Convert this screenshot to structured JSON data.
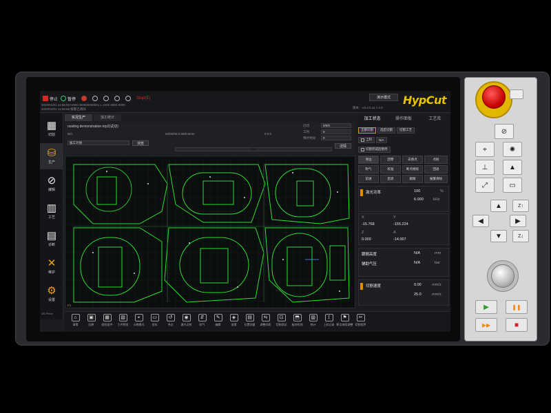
{
  "topbar": {
    "items": [
      {
        "label": "停止"
      },
      {
        "label": "暂停"
      },
      {
        "label": ""
      },
      {
        "label": ""
      },
      {
        "label": ""
      },
      {
        "label": ""
      },
      {
        "label": "Stop(E)"
      }
    ],
    "status_line_1": "2020/01/01 11:58:58  H000 000000000001  L 1000  0000 0000",
    "status_line_2": "2020/01/01 11:58:58  报警已清除",
    "mode_button": "演示模式",
    "version": "版本：V3.4.0.11.7.2.0",
    "brand": "HypCut"
  },
  "sidebar": {
    "items": [
      {
        "label": "切割",
        "glyph": "▦"
      },
      {
        "label": "生产",
        "glyph": "⛁"
      },
      {
        "label": "编辑",
        "glyph": "⊘"
      },
      {
        "label": "工艺",
        "glyph": "▥"
      },
      {
        "label": "诊断",
        "glyph": "▤"
      },
      {
        "label": "维护",
        "glyph": "✕"
      },
      {
        "label": "设置",
        "glyph": "⚙"
      }
    ]
  },
  "main": {
    "tabs": [
      {
        "label": "实况生产"
      },
      {
        "label": "加工统计"
      }
    ],
    "file_name": "nesting demonstration.nrp2(试切)",
    "path_label": "N/A",
    "time_1": "02/00/00  0.00/0.0mm",
    "time_2": "0  0 0",
    "plan_label": "加工计划",
    "browse_button": "浏览",
    "stats": [
      {
        "label": "已切",
        "value": "0/0/0"
      },
      {
        "label": "工时",
        "value": "0"
      },
      {
        "label": "预计时间",
        "value": "0"
      }
    ],
    "stats_button": "详情",
    "progress_label": "0%",
    "progress_value": 0.0,
    "scale_label": "1/1"
  },
  "rpanel": {
    "tabs": [
      {
        "label": "加工状态"
      },
      {
        "label": "操作面板"
      },
      {
        "label": "工艺库"
      }
    ],
    "chips_row1": [
      "全部切割",
      "选区切割",
      "切割工艺"
    ],
    "labels_row2": [
      "上料",
      "N/A"
    ],
    "check_row3": "切割完成后暂停",
    "buttons_grid": [
      {
        "label": "寻边"
      },
      {
        "label": "回零"
      },
      {
        "label": "去原点"
      },
      {
        "label": "点射"
      },
      {
        "label": "吹气"
      },
      {
        "label": "校准"
      },
      {
        "label": "断点继续"
      },
      {
        "label": "回退"
      },
      {
        "label": "前进"
      },
      {
        "label": "后退"
      },
      {
        "label": "跟随"
      },
      {
        "label": "报警清除"
      }
    ],
    "laser": {
      "title": "激光功率",
      "value": "100",
      "unit": "%",
      "freq": "6.000",
      "freq_unit": "kHz"
    },
    "axis_labels": [
      "X",
      "Y",
      "Z",
      "A"
    ],
    "coords": {
      "x": "-15.768",
      "y": "-155.224",
      "z": "0.000",
      "a": "-14.007"
    },
    "follow": {
      "label": "跟随高度",
      "value": "N/A",
      "unit": "mm"
    },
    "gas": {
      "label": "辅助气压",
      "value": "N/A",
      "unit": "bar"
    },
    "speed": {
      "label": "切割速度",
      "value": "0.00",
      "unit": "mm/s"
    },
    "speed2": {
      "value": "25.0",
      "unit": "mm/s"
    }
  },
  "bottombar": {
    "items": [
      {
        "label": "清零",
        "glyph": "⌂"
      },
      {
        "label": "回原",
        "glyph": "▣"
      },
      {
        "label": "图形居中",
        "glyph": "▦"
      },
      {
        "label": "工件预览",
        "glyph": "▧"
      },
      {
        "label": "示教模式",
        "glyph": "⌖"
      },
      {
        "label": "坐标",
        "glyph": "▭"
      },
      {
        "label": "寻边",
        "glyph": "↺"
      },
      {
        "label": "激光点射",
        "glyph": "◉"
      },
      {
        "label": "吹气",
        "glyph": "⇵"
      },
      {
        "label": "编辑",
        "glyph": "✎"
      },
      {
        "label": "追零",
        "glyph": "◈"
      },
      {
        "label": "位置测量",
        "glyph": "▤"
      },
      {
        "label": "调整间距",
        "glyph": "⇆"
      },
      {
        "label": "切割测试",
        "glyph": "⊡"
      },
      {
        "label": "板材检测",
        "glyph": "⬒"
      },
      {
        "label": "统计",
        "glyph": "▥"
      },
      {
        "label": "上料记录",
        "glyph": "⟟"
      },
      {
        "label": "断点继续调整",
        "glyph": "⚑"
      },
      {
        "label": "切割程序",
        "glyph": "✂"
      }
    ],
    "note": "1/6 Piece"
  },
  "keypad": {
    "rows": [
      [
        "",
        "⊘",
        ""
      ],
      [
        "⌖",
        "✺",
        ""
      ],
      [
        "⊥",
        "▲",
        ""
      ],
      [
        "⤢",
        "▭",
        ""
      ]
    ],
    "arrows": [
      "▲",
      "◀",
      "▶",
      "▼",
      "Z↑",
      "Z↓"
    ],
    "transport": [
      {
        "glyph": "▶",
        "color": "#2ca02c"
      },
      {
        "glyph": "❚❚",
        "color": "#f08a1c"
      },
      {
        "glyph": "▶▶",
        "color": "#f08a1c"
      },
      {
        "glyph": "■",
        "color": "#d61f1f"
      }
    ]
  },
  "chart_data": {}
}
